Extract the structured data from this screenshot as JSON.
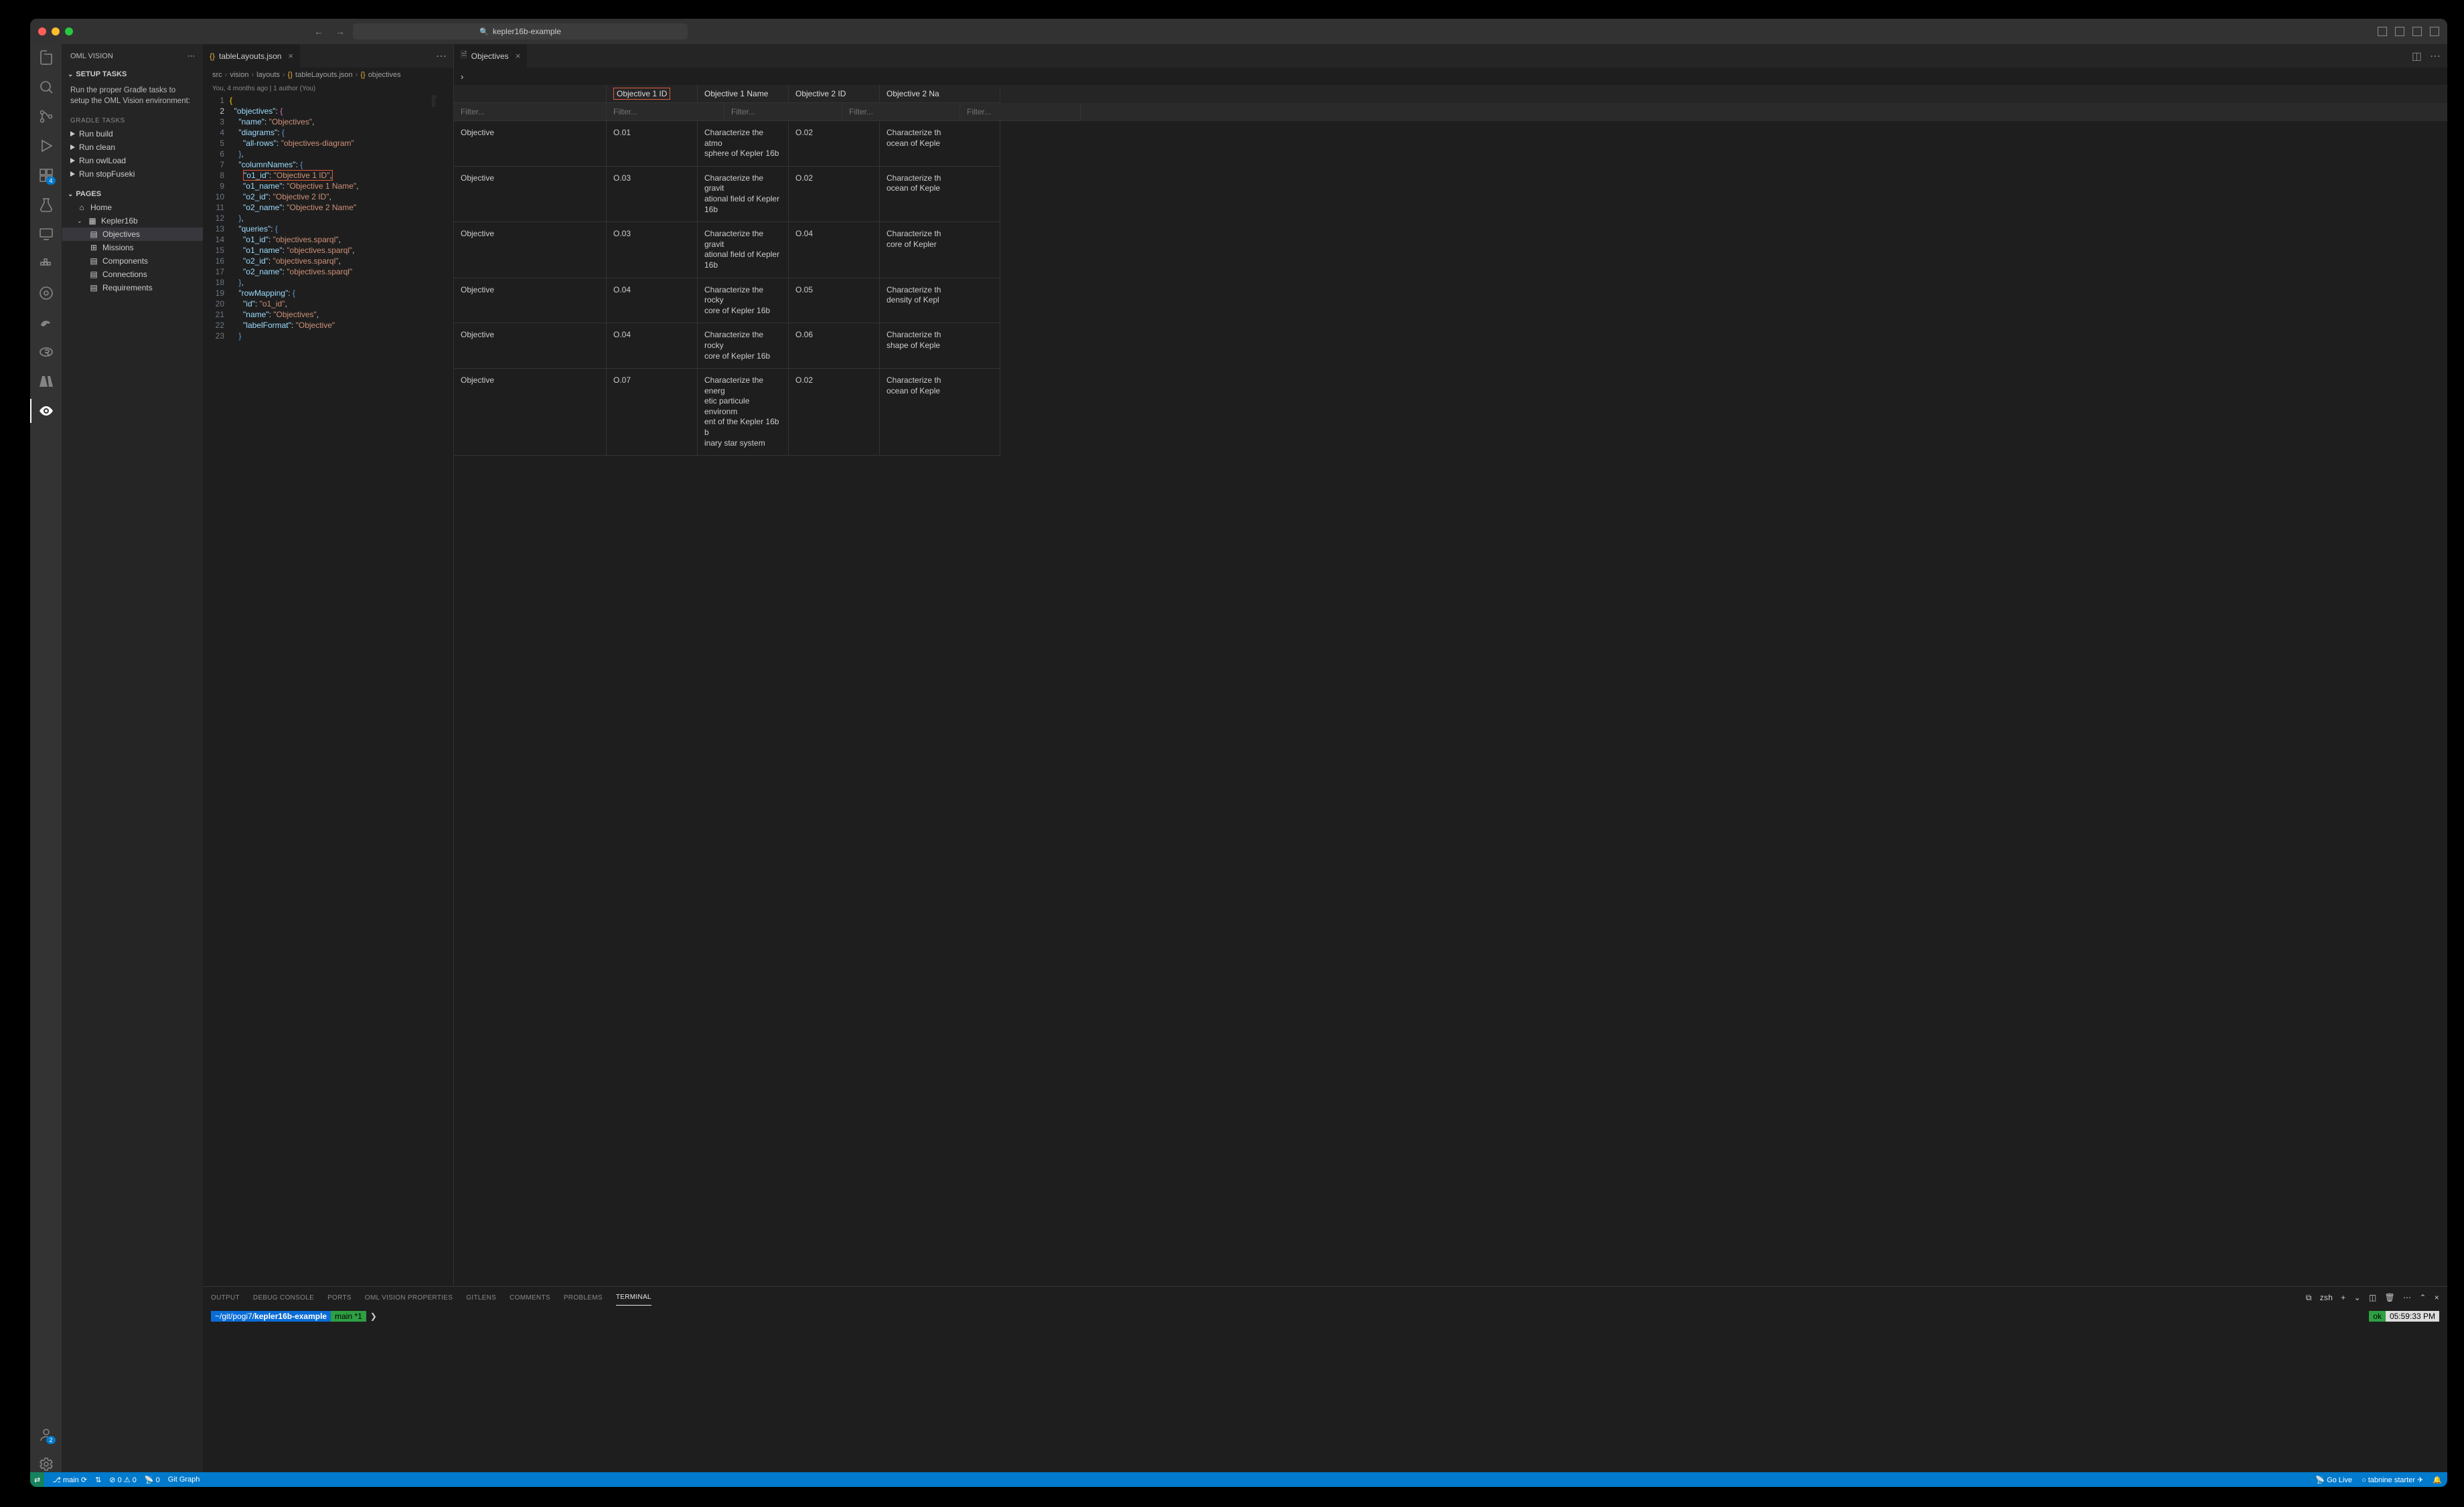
{
  "titlebar": {
    "search": "kepler16b-example"
  },
  "sidebar": {
    "title": "OML VISION",
    "setup_section": "SETUP TASKS",
    "setup_text": "Run the proper Gradle tasks to setup the OML Vision environment:",
    "gradle_title": "GRADLE TASKS",
    "tasks": [
      "Run build",
      "Run clean",
      "Run owlLoad",
      "Run stopFuseki"
    ],
    "pages_section": "PAGES",
    "tree": {
      "home": "Home",
      "project": "Kepler16b",
      "children": [
        "Objectives",
        "Missions",
        "Components",
        "Connections",
        "Requirements"
      ]
    }
  },
  "editor": {
    "tab": "tableLayouts.json",
    "breadcrumbs": [
      "src",
      "vision",
      "layouts",
      "tableLayouts.json",
      "objectives"
    ],
    "blame": "You, 4 months ago | 1 author (You)",
    "json": {
      "name": "Objectives",
      "all_rows": "objectives-diagram",
      "columnNames": {
        "o1_id": "Objective 1 ID",
        "o1_name": "Objective 1 Name",
        "o2_id": "Objective 2 ID",
        "o2_name": "Objective 2 Name"
      },
      "queries_val": "objectives.sparql",
      "rowMapping": {
        "id": "o1_id",
        "name": "Objectives",
        "labelFormat": "Objective"
      }
    }
  },
  "pane2": {
    "tab": "Objectives",
    "breadcrumb": "›",
    "headers": [
      "",
      "Objective 1 ID",
      "Objective 1 Name",
      "Objective 2 ID",
      "Objective 2 Na"
    ],
    "filter_placeholder": "Filter...",
    "rows": [
      {
        "c0": "Objective",
        "c1": "O.01",
        "c2": "Characterize the atmo\nsphere of Kepler 16b",
        "c3": "O.02",
        "c4": "Characterize th\nocean of Keple"
      },
      {
        "c0": "Objective",
        "c1": "O.03",
        "c2": "Characterize the gravit\national field of Kepler\n16b",
        "c3": "O.02",
        "c4": "Characterize th\nocean of Keple"
      },
      {
        "c0": "Objective",
        "c1": "O.03",
        "c2": "Characterize the gravit\national field of Kepler\n16b",
        "c3": "O.04",
        "c4": "Characterize th\ncore of Kepler"
      },
      {
        "c0": "Objective",
        "c1": "O.04",
        "c2": "Characterize the rocky\ncore of Kepler 16b",
        "c3": "O.05",
        "c4": "Characterize th\ndensity of Kepl"
      },
      {
        "c0": "Objective",
        "c1": "O.04",
        "c2": "Characterize the rocky\ncore of Kepler 16b",
        "c3": "O.06",
        "c4": "Characterize th\nshape of Keple"
      },
      {
        "c0": "Objective",
        "c1": "O.07",
        "c2": "Characterize the energ\netic particule environm\nent of the Kepler 16b b\ninary star system",
        "c3": "O.02",
        "c4": "Characterize th\nocean of Keple"
      }
    ]
  },
  "panel": {
    "tabs": [
      "OUTPUT",
      "DEBUG CONSOLE",
      "PORTS",
      "OML VISION PROPERTIES",
      "GITLENS",
      "COMMENTS",
      "PROBLEMS",
      "TERMINAL"
    ],
    "shell": "zsh",
    "term_path": "~/git/pogi7/",
    "term_project": "kepler16b-example",
    "term_branch": "main *1",
    "term_status": "ok",
    "term_time": "05:59:33 PM"
  },
  "status": {
    "branch": "main",
    "errors": "0",
    "warnings": "0",
    "ports": "0",
    "gitgraph": "Git Graph",
    "golive": "Go Live",
    "tabnine": "tabnine starter"
  }
}
